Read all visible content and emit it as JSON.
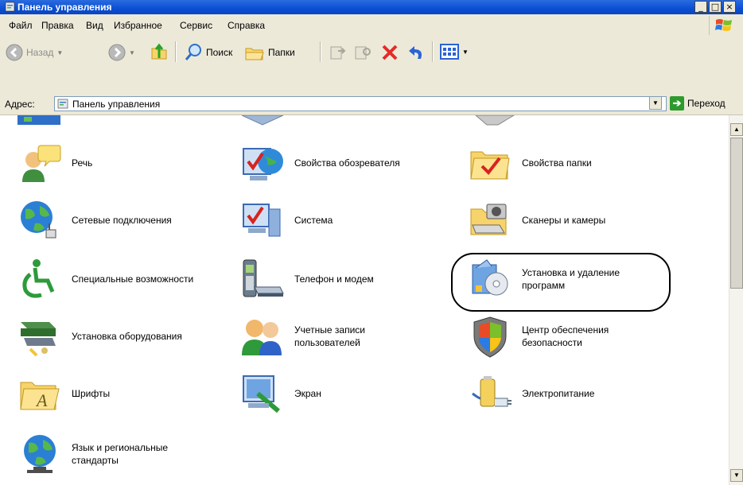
{
  "window": {
    "title": "Панель управления",
    "controls": [
      "_",
      "□",
      "×"
    ]
  },
  "menu": {
    "items": [
      "Файл",
      "Правка",
      "Вид",
      "Избранное",
      "Сервис",
      "Справка"
    ]
  },
  "toolbar": {
    "back_label": "Назад",
    "search_label": "Поиск",
    "folders_label": "Папки"
  },
  "address": {
    "label": "Адрес:",
    "value": "Панель управления",
    "go_label": "Переход"
  },
  "items": [
    {
      "label": "Речь",
      "icon": "speech-icon"
    },
    {
      "label": "Свойства обозревателя",
      "icon": "internet-options-icon"
    },
    {
      "label": "Свойства папки",
      "icon": "folder-options-icon"
    },
    {
      "label": "Сетевые подключения",
      "icon": "network-connections-icon"
    },
    {
      "label": "Система",
      "icon": "system-icon"
    },
    {
      "label": "Сканеры и камеры",
      "icon": "scanners-cameras-icon"
    },
    {
      "label": "Специальные возможности",
      "icon": "accessibility-icon"
    },
    {
      "label": "Телефон и модем",
      "icon": "phone-modem-icon"
    },
    {
      "label": "Установка и удаление программ",
      "icon": "add-remove-programs-icon",
      "highlighted": true
    },
    {
      "label": "Установка оборудования",
      "icon": "add-hardware-icon"
    },
    {
      "label": "Учетные записи пользователей",
      "icon": "user-accounts-icon"
    },
    {
      "label": "Центр обеспечения безопасности",
      "icon": "security-center-icon"
    },
    {
      "label": "Шрифты",
      "icon": "fonts-folder-icon"
    },
    {
      "label": "Экран",
      "icon": "display-icon"
    },
    {
      "label": "Электропитание",
      "icon": "power-options-icon"
    },
    {
      "label": "Язык и региональные стандарты",
      "icon": "regional-options-icon"
    }
  ]
}
